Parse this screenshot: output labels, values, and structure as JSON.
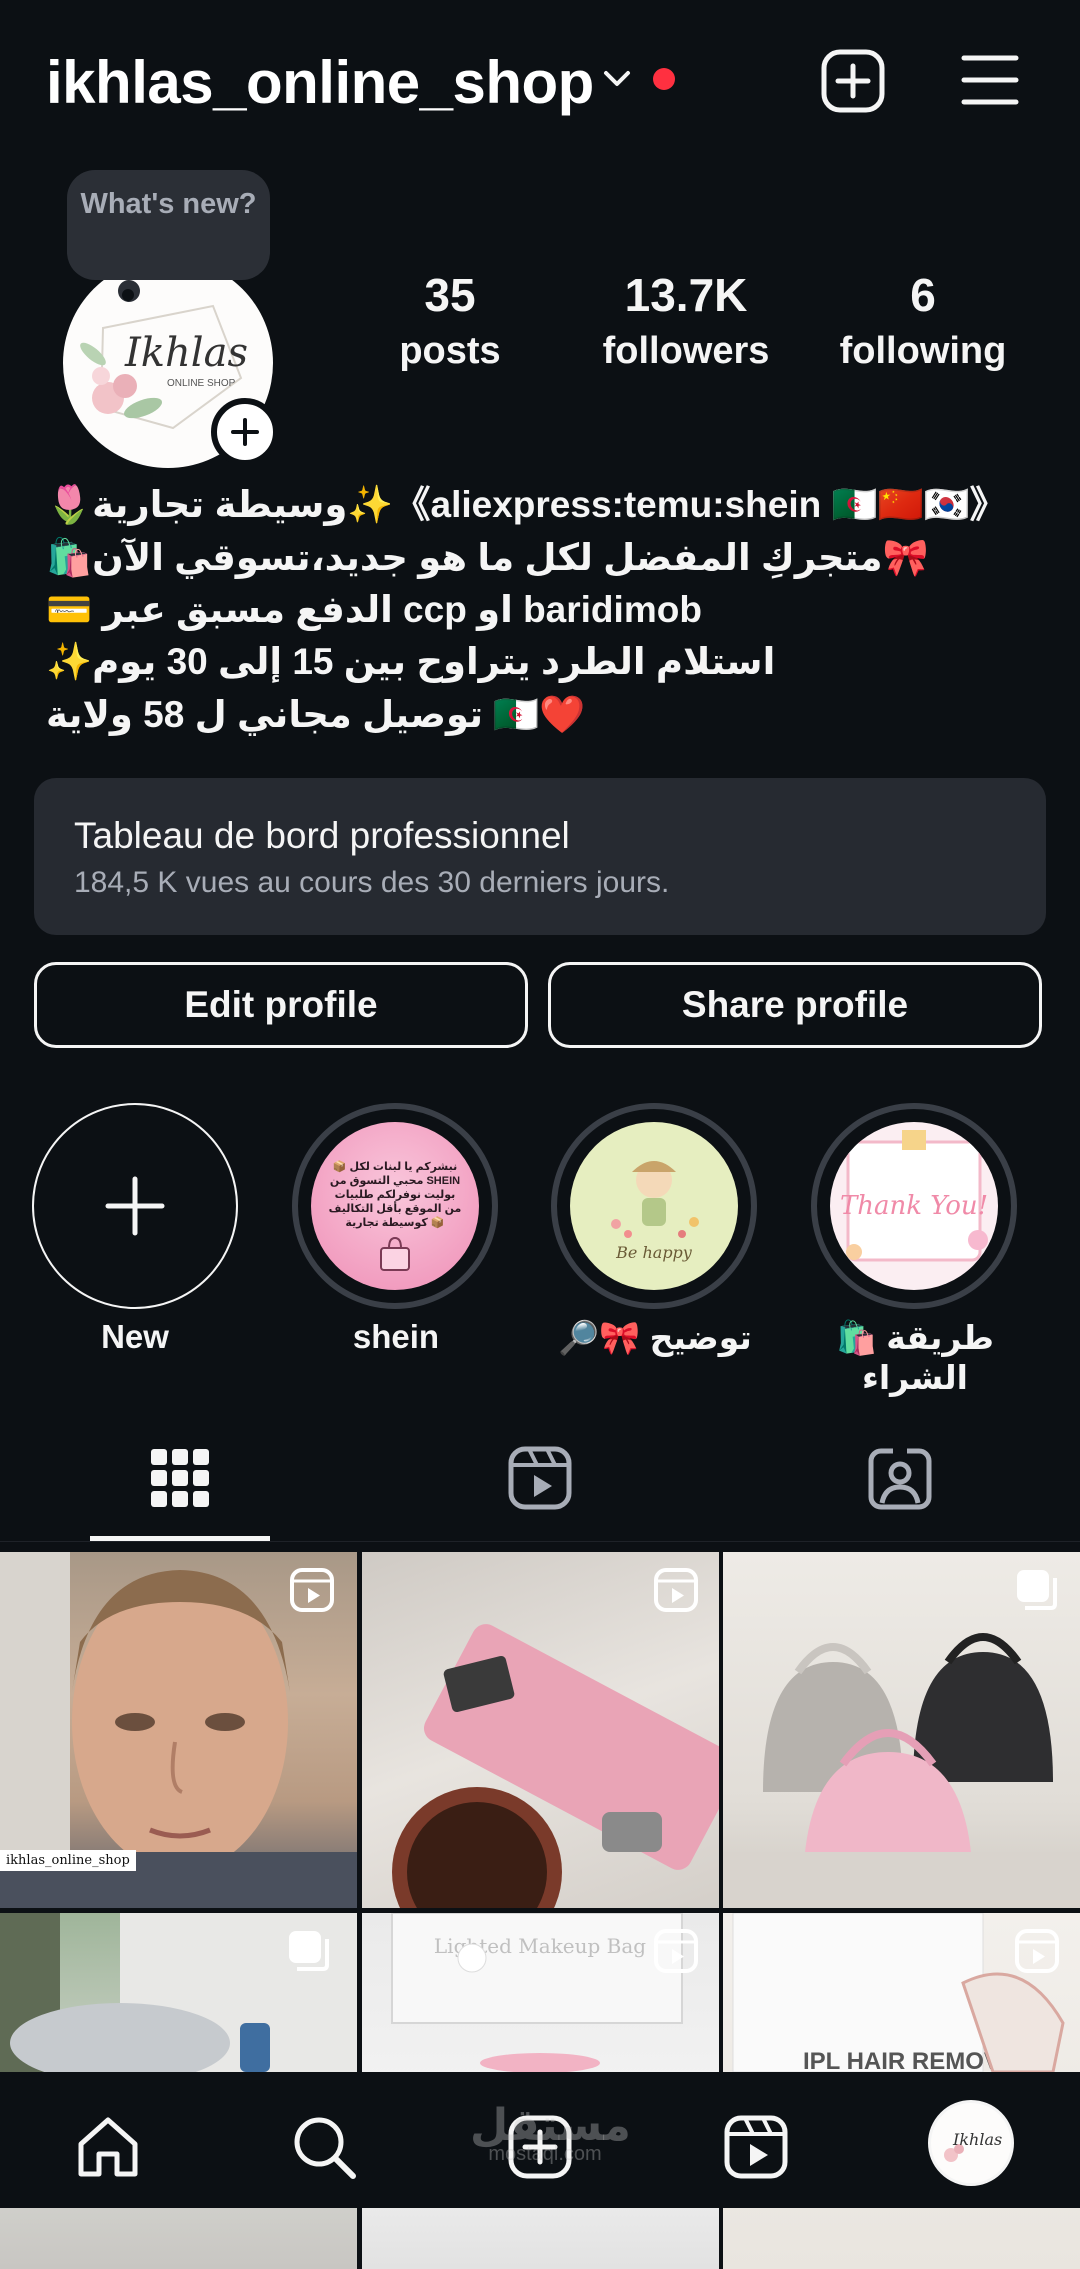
{
  "header": {
    "username": "ikhlas_online_shop",
    "notification_color": "#ff3040"
  },
  "profile": {
    "avatar_logo_text": "Ikhlas",
    "avatar_logo_sub": "ONLINE SHOP",
    "whats_new": "What's new?",
    "stats": [
      {
        "value": "35",
        "label": "posts"
      },
      {
        "value": "13.7K",
        "label": "followers"
      },
      {
        "value": "6",
        "label": "following"
      }
    ]
  },
  "bio": {
    "line1": "🌷وسيطة تجارية✨《aliexpress:temu:shein 🇩🇿🇨🇳🇰🇷》",
    "line2": "🛍️متجركِ المفضل لكل ما هو جديد،تسوقي الآن🎀",
    "line3": "💳 الدفع مسبق عبر ccp او baridimob",
    "line4": "✨استلام الطرد يتراوح بين 15 إلى 30 يوم",
    "line5": "توصيل مجاني ل 58 ولاية 🇩🇿❤️"
  },
  "dashboard": {
    "title": "Tableau de bord professionnel",
    "subtitle": "184,5 K vues au cours des 30 derniers jours."
  },
  "buttons": {
    "edit": "Edit profile",
    "share": "Share profile"
  },
  "highlights": [
    {
      "label": "New",
      "icon": "plus-icon"
    },
    {
      "label": "shein",
      "cover_text": "📦 نبشركم يا لبنات لكل محبي التسوق من SHEIN بوليت نوفرلكم طلبيات من الموقع بأقل التكاليف كوسيطة تجارية 📦"
    },
    {
      "label": "🔎🎀 توضيح",
      "cover_text": "Be happy"
    },
    {
      "label": "🛍️ طريقة الشراء",
      "cover_text": "Thank You!"
    }
  ],
  "tabs": [
    {
      "name": "grid-icon",
      "active": true
    },
    {
      "name": "reels-icon",
      "active": false
    },
    {
      "name": "tagged-icon",
      "active": false
    }
  ],
  "grid": {
    "tag_text": "ikhlas_online_shop",
    "post5_text": "Lighted Makeup Bag",
    "post6_text": "IPL HAIR REMOVAL"
  },
  "watermark": {
    "text": "مستقل",
    "sub": "mostaql.com"
  },
  "colors": {
    "background": "#0c1014",
    "card": "#262a31",
    "text": "#f5f5f5",
    "muted": "#a8adb7"
  }
}
